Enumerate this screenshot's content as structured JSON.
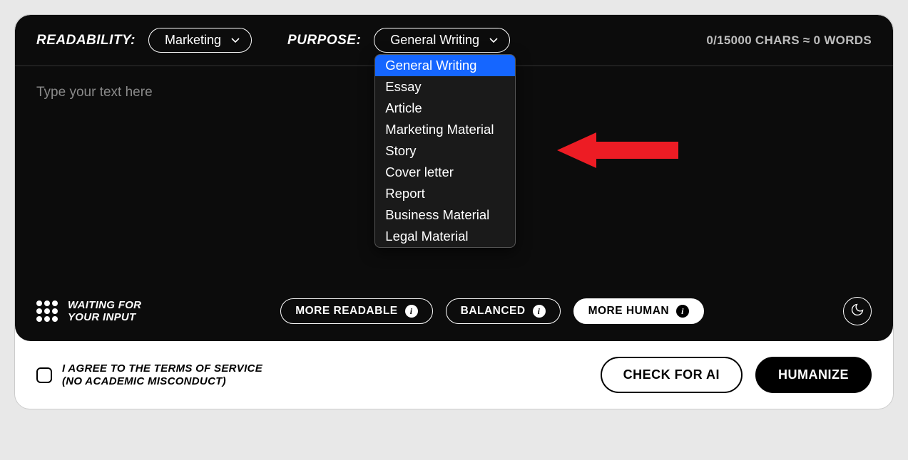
{
  "header": {
    "readability_label": "READABILITY:",
    "readability_value": "Marketing",
    "purpose_label": "PURPOSE:",
    "purpose_value": "General Writing",
    "char_count": "0/15000 CHARS ≈ 0 WORDS"
  },
  "purpose_options": [
    "General Writing",
    "Essay",
    "Article",
    "Marketing Material",
    "Story",
    "Cover letter",
    "Report",
    "Business Material",
    "Legal Material"
  ],
  "editor": {
    "placeholder": "Type your text here"
  },
  "status": {
    "line1": "WAITING FOR",
    "line2": "YOUR INPUT"
  },
  "modes": {
    "more_readable": "MORE READABLE",
    "balanced": "BALANCED",
    "more_human": "MORE HUMAN"
  },
  "footer": {
    "tos_line1": "I AGREE TO THE TERMS OF SERVICE",
    "tos_line2": "(NO ACADEMIC MISCONDUCT)",
    "check_ai": "CHECK FOR AI",
    "humanize": "HUMANIZE"
  }
}
